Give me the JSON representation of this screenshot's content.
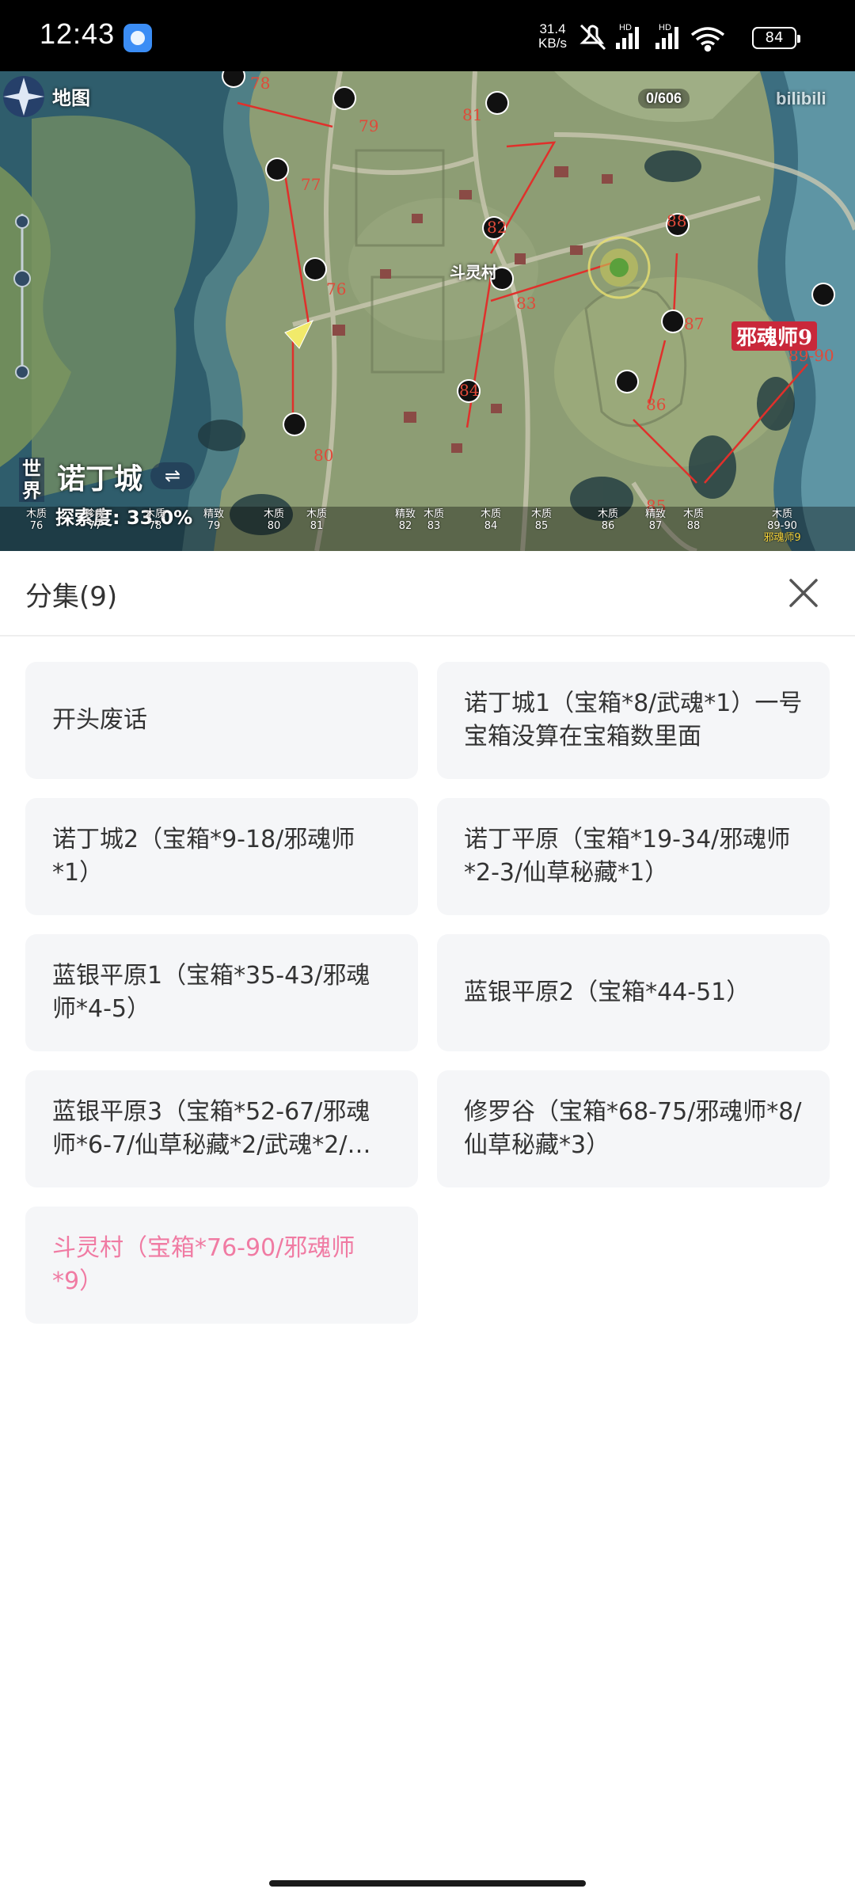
{
  "status_bar": {
    "time": "12:43",
    "net_speed_value": "31.4",
    "net_speed_unit": "KB/s",
    "battery": "84"
  },
  "video": {
    "map_title": "地图",
    "city_name": "诺丁城",
    "world_label": "世界",
    "exploration": "探索度: 33.0%",
    "village_name": "斗灵村",
    "evil_master_label": "邪魂师9",
    "counter": "0/606",
    "watermark": "bilibili",
    "markers": [
      "76",
      "77",
      "78",
      "79",
      "80",
      "81",
      "82",
      "83",
      "84",
      "85",
      "86",
      "87",
      "88",
      "89-90"
    ],
    "timeline": [
      {
        "tag": "木质",
        "num": "76"
      },
      {
        "tag": "珍贵",
        "num": "77"
      },
      {
        "tag": "木质",
        "num": "78"
      },
      {
        "tag": "精致",
        "num": "79"
      },
      {
        "tag": "木质",
        "num": "80"
      },
      {
        "tag": "木质",
        "num": "81"
      },
      {
        "tag": "精致",
        "num": "82"
      },
      {
        "tag": "木质",
        "num": "83"
      },
      {
        "tag": "木质",
        "num": "84"
      },
      {
        "tag": "木质",
        "num": "85"
      },
      {
        "tag": "木质",
        "num": "86"
      },
      {
        "tag": "精致",
        "num": "87"
      },
      {
        "tag": "木质",
        "num": "88"
      },
      {
        "tag": "木质",
        "num": "89-90"
      }
    ],
    "timeline_last_extra": "邪魂师9"
  },
  "sheet": {
    "title": "分集(9)",
    "episodes": [
      {
        "label": "开头废话",
        "active": false
      },
      {
        "label": "诺丁城1（宝箱*8/武魂*1）一号宝箱没算在宝箱数里面",
        "active": false
      },
      {
        "label": "诺丁城2（宝箱*9-18/邪魂师*1）",
        "active": false
      },
      {
        "label": "诺丁平原（宝箱*19-34/邪魂师*2-3/仙草秘藏*1）",
        "active": false
      },
      {
        "label": "蓝银平原1（宝箱*35-43/邪魂师*4-5）",
        "active": false
      },
      {
        "label": "蓝银平原2（宝箱*44-51）",
        "active": false
      },
      {
        "label": "蓝银平原3（宝箱*52-67/邪魂师*6-7/仙草秘藏*2/武魂*2/…",
        "active": false
      },
      {
        "label": "修罗谷（宝箱*68-75/邪魂师*8/仙草秘藏*3）",
        "active": false
      },
      {
        "label": "斗灵村（宝箱*76-90/邪魂师*9）",
        "active": true
      }
    ],
    "active_color": "#f07ba3"
  }
}
